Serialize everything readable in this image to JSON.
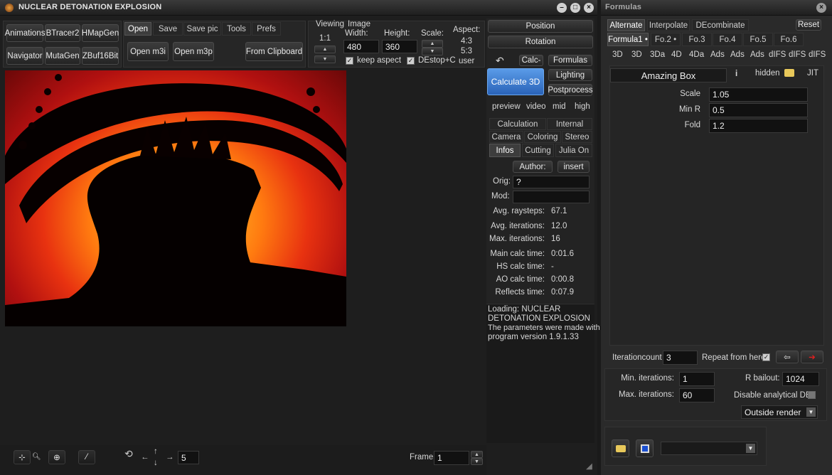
{
  "main_window": {
    "title": "NUCLEAR DETONATION EXPLOSION",
    "tools": [
      "Animations",
      "BTracer2",
      "HMapGen",
      "Navigator",
      "MutaGen",
      "ZBuf16Bit"
    ],
    "file_tabs": [
      "Open",
      "Save",
      "Save pic",
      "Tools",
      "Prefs"
    ],
    "open_m3i": "Open m3i",
    "open_m3p": "Open m3p",
    "from_clipboard": "From Clipboard",
    "viewing_label": "Viewing",
    "viewing_ratio": "1:1",
    "image_label": "Image",
    "width_label": "Width:",
    "width_value": "480",
    "height_label": "Height:",
    "height_value": "360",
    "scale_label": "Scale:",
    "aspect_label": "Aspect:",
    "aspect_options": [
      "4:3",
      "5:3",
      "user"
    ],
    "keep_aspect": "keep aspect",
    "destop": "DEstop+C",
    "bottom": {
      "step_value": "5",
      "frame_label": "Frame:",
      "frame_value": "1"
    }
  },
  "mid_panel": {
    "position": "Position",
    "rotation": "Rotation",
    "calc_btn": "Calc-",
    "formulas_btn": "Formulas",
    "calculate_3d": "Calculate 3D",
    "lighting": "Lighting",
    "postprocess": "Postprocess",
    "quality": [
      "preview",
      "video",
      "mid",
      "high"
    ],
    "tabs_row1": [
      "Calculation",
      "Internal"
    ],
    "tabs_row2": [
      "Camera",
      "Coloring",
      "Stereo"
    ],
    "tabs_row3": [
      "Infos",
      "Cutting",
      "Julia On"
    ],
    "author_btn": "Author:",
    "insert_btn": "insert",
    "orig_label": "Orig:",
    "orig_value": "?",
    "mod_label": "Mod:",
    "mod_value": "",
    "stats": [
      {
        "label": "Avg. raysteps:",
        "value": "67.1"
      },
      {
        "label": "Avg. iterations:",
        "value": "12.0"
      },
      {
        "label": "Max. iterations:",
        "value": "16"
      },
      {
        "label": "Main calc time:",
        "value": "0:01.6"
      },
      {
        "label": "HS calc time:",
        "value": "-"
      },
      {
        "label": "AO calc time:",
        "value": "0:00.8"
      },
      {
        "label": "Reflects time:",
        "value": "0:07.9"
      }
    ],
    "log": [
      "Loading: NUCLEAR",
      "DETONATION EXPLOSION",
      "The parameters were made with",
      "program version 1.9.1.33"
    ]
  },
  "formulas_window": {
    "title": "Formulas",
    "mode_tabs": [
      "Alternate",
      "Interpolate",
      "DEcombinate"
    ],
    "reset": "Reset",
    "formula_tabs": [
      "Formula1 •",
      "Fo.2 •",
      "Fo.3",
      "Fo.4",
      "Fo.5",
      "Fo.6"
    ],
    "type_tabs": [
      "3D",
      "3D",
      "3Da",
      "4D",
      "4Da",
      "Ads",
      "Ads",
      "Ads",
      "dIFS",
      "dIFS",
      "dIFS"
    ],
    "formula_name": "Amazing Box",
    "info": "i",
    "hidden": "hidden",
    "jit": "JIT",
    "params": [
      {
        "label": "Scale",
        "value": "1.05"
      },
      {
        "label": "Min R",
        "value": "0.5"
      },
      {
        "label": "Fold",
        "value": "1.2"
      }
    ],
    "iterationcount_label": "Iterationcount",
    "iterationcount_value": "3",
    "repeat_label": "Repeat from here",
    "min_iter_label": "Min. iterations:",
    "min_iter_value": "1",
    "max_iter_label": "Max. iterations:",
    "max_iter_value": "60",
    "r_bailout_label": "R bailout:",
    "r_bailout_value": "1024",
    "disable_de_label": "Disable analytical DE",
    "outside_render": "Outside render",
    "preset_value": ""
  }
}
